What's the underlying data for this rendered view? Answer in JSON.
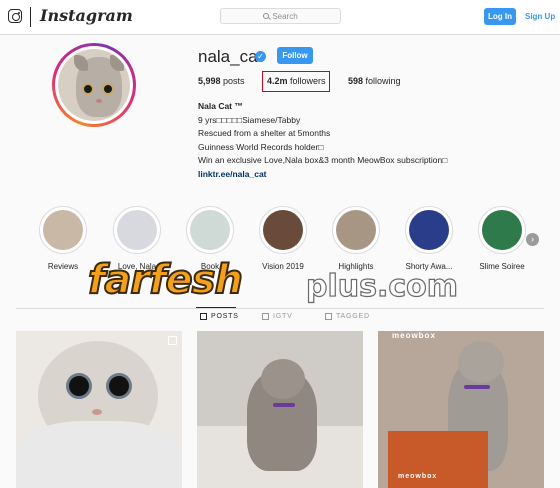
{
  "nav": {
    "wordmark": "Instagram",
    "search_placeholder": "Search",
    "login_label": "Log In",
    "signup_label": "Sign Up"
  },
  "profile": {
    "username": "nala_cat",
    "verified_mark": "✓",
    "follow_label": "Follow",
    "posts_count": "5,998",
    "posts_label": "posts",
    "followers_count": "4.2m",
    "followers_label": "followers",
    "following_count": "598",
    "following_label": "following",
    "bio_name": "Nala Cat ™",
    "bio_lines": [
      "9 yrs□□□□□Siamese/Tabby",
      "Rescued from a shelter at 5months",
      "Guinness World Records holder□",
      "Win an exclusive Love,Nala box&3 month MeowBox subscription□"
    ],
    "bio_link": "linktr.ee/nala_cat"
  },
  "highlights": [
    {
      "label": "Reviews",
      "color": "#c9b8a6"
    },
    {
      "label": "Love, Nala",
      "color": "#d7d9de"
    },
    {
      "label": "Book",
      "color": "#cfd9d6"
    },
    {
      "label": "Vision 2019",
      "color": "#6a4a3a"
    },
    {
      "label": "Highlights",
      "color": "#a89684"
    },
    {
      "label": "Shorty Awa...",
      "color": "#2a3d8a"
    },
    {
      "label": "Slime Soiree",
      "color": "#2f7a4a"
    }
  ],
  "highlights_next_icon": "›",
  "watermark": {
    "main": "farfesh",
    "sub": "plus.com"
  },
  "tabs": {
    "posts": "POSTS",
    "igtv": "IGTV",
    "tagged": "TAGGED"
  },
  "posts": {
    "post3_box_label": "meowbox",
    "post3_top_label": "meowbox"
  },
  "colors": {
    "accent": "#3897f0",
    "highlight_box": "#d0021b",
    "link": "#003569"
  }
}
